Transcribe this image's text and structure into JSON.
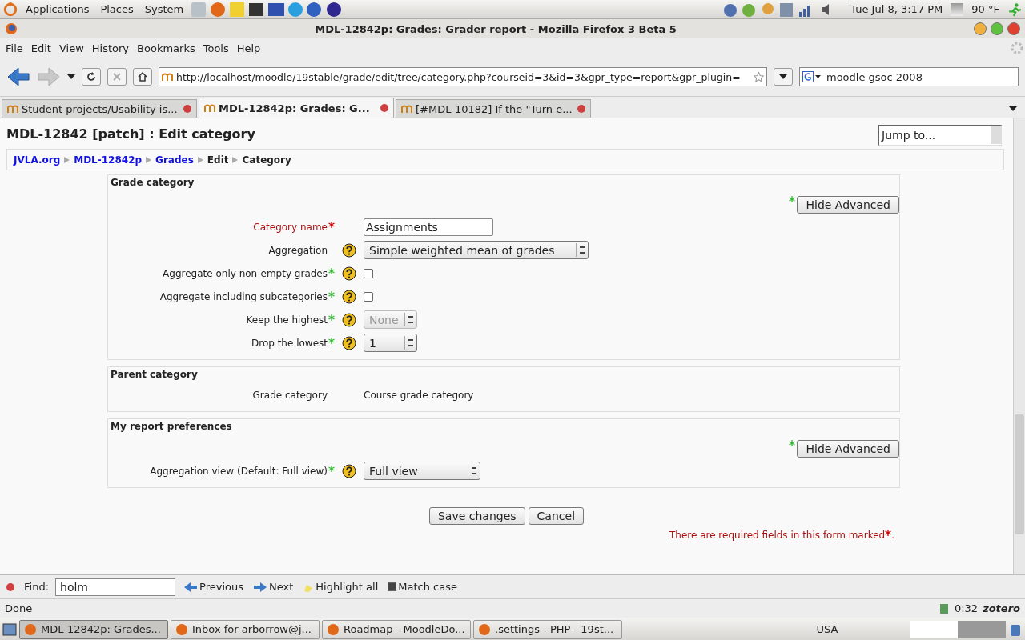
{
  "top_panel": {
    "menus": [
      "Applications",
      "Places",
      "System"
    ],
    "clock": "Tue Jul  8,  3:17 PM",
    "weather": "90 °F"
  },
  "window": {
    "title": "MDL-12842p: Grades: Grader report - Mozilla Firefox 3 Beta 5"
  },
  "menu": [
    "File",
    "Edit",
    "View",
    "History",
    "Bookmarks",
    "Tools",
    "Help"
  ],
  "toolbar": {
    "url": "http://localhost/moodle/19stable/grade/edit/tree/category.php?courseid=3&id=3&gpr_type=report&gpr_plugin=",
    "search": "moodle gsoc 2008"
  },
  "tabs": [
    {
      "label": "Student projects/Usability is...",
      "selected": false
    },
    {
      "label": "MDL-12842p: Grades: G...",
      "selected": true
    },
    {
      "label": "[#MDL-10182] If the \"Turn e...",
      "selected": false
    }
  ],
  "page": {
    "heading": "MDL-12842 [patch] : Edit category",
    "jump": "Jump to...",
    "breadcrumb": [
      {
        "label": "JVLA.org",
        "kind": "link"
      },
      {
        "label": "MDL-12842p",
        "kind": "link"
      },
      {
        "label": "Grades",
        "kind": "link"
      },
      {
        "label": "Edit",
        "kind": "text"
      },
      {
        "label": "Category",
        "kind": "text"
      }
    ],
    "sections": [
      {
        "legend": "Grade category",
        "advanced_button": "Hide Advanced",
        "fields": [
          {
            "label": "Category name",
            "kind": "text",
            "required": true,
            "help": false,
            "value": "Assignments"
          },
          {
            "label": "Aggregation",
            "kind": "select",
            "required": false,
            "advanced": false,
            "help": true,
            "value": "Simple weighted mean of grades",
            "disabled": false
          },
          {
            "label": "Aggregate only non-empty grades",
            "kind": "checkbox",
            "required": false,
            "advanced": true,
            "help": true,
            "checked": false
          },
          {
            "label": "Aggregate including subcategories",
            "kind": "checkbox",
            "required": false,
            "advanced": true,
            "help": true,
            "checked": false
          },
          {
            "label": "Keep the highest",
            "kind": "spin",
            "required": false,
            "advanced": true,
            "help": true,
            "value": "None",
            "disabled": true
          },
          {
            "label": "Drop the lowest",
            "kind": "spin",
            "required": false,
            "advanced": true,
            "help": true,
            "value": "1",
            "disabled": false
          }
        ]
      },
      {
        "legend": "Parent category",
        "fields": [
          {
            "label": "Grade category",
            "kind": "static",
            "required": false,
            "advanced": false,
            "help": false,
            "value": "Course grade category"
          }
        ]
      },
      {
        "legend": "My report preferences",
        "advanced_button": "Hide Advanced",
        "fields": [
          {
            "label": "Aggregation view (Default: Full view)",
            "kind": "select",
            "required": false,
            "advanced": true,
            "help": true,
            "value": "Full view",
            "disabled": false
          }
        ]
      }
    ],
    "buttons": [
      "Save changes",
      "Cancel"
    ],
    "required_note": "There are required fields in this form marked",
    "required_note_end": "."
  },
  "find_bar": {
    "label": "Find:",
    "value": "holm",
    "previous": "Previous",
    "next": "Next",
    "highlight": "Highlight all",
    "match_case": "Match case",
    "match_checked": true
  },
  "status_bar": {
    "text": "Done",
    "time": "0:32",
    "addon": "zotero"
  },
  "taskbar": {
    "tasks": [
      {
        "label": "MDL-12842p: Grades...",
        "selected": true
      },
      {
        "label": "Inbox for arborrow@j...",
        "selected": false
      },
      {
        "label": "Roadmap - MoodleDo...",
        "selected": false
      },
      {
        "label": ".settings - PHP - 19st...",
        "selected": false
      }
    ],
    "keyboard": "USA"
  }
}
